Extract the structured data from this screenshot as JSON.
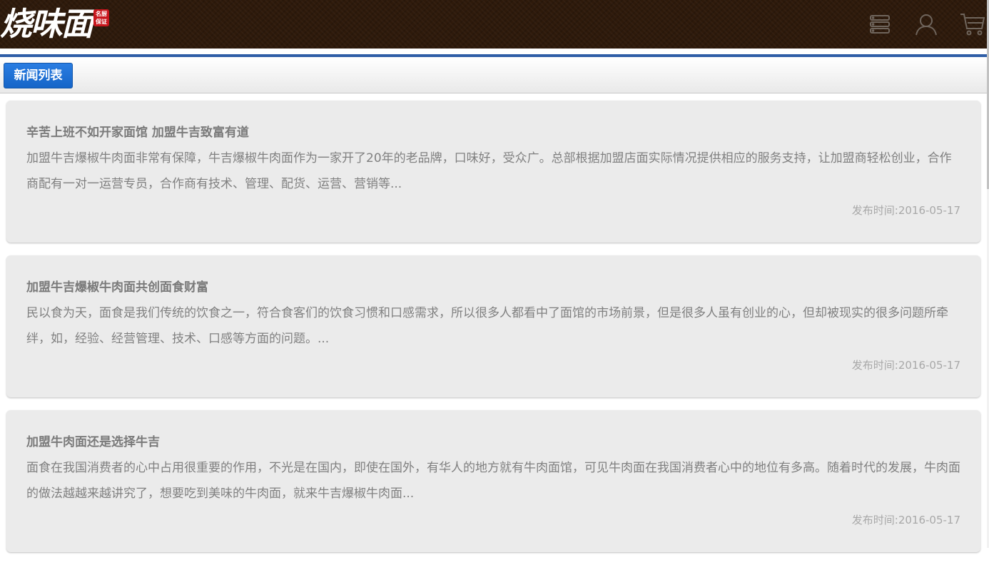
{
  "header": {
    "logo_text": "烧味面",
    "logo_seal": "名厨保证",
    "icons": [
      "menu-list-icon",
      "user-icon",
      "cart-icon"
    ],
    "background_color": "#2e1a0b"
  },
  "tabs": {
    "active_label": "新闻列表",
    "accent_color": "#1a6fd6"
  },
  "news": [
    {
      "title": "辛苦上班不如开家面馆 加盟牛吉致富有道",
      "summary": "加盟牛吉爆椒牛肉面非常有保障，牛吉爆椒牛肉面作为一家开了20年的老品牌，口味好，受众广。总部根据加盟店面实际情况提供相应的服务支持，让加盟商轻松创业，合作商配有一对一运营专员，合作商有技术、管理、配货、运营、营销等...",
      "date": "发布时间:2016-05-17"
    },
    {
      "title": "加盟牛吉爆椒牛肉面共创面食财富",
      "summary": "民以食为天，面食是我们传统的饮食之一，符合食客们的饮食习惯和口感需求，所以很多人都看中了面馆的市场前景，但是很多人虽有创业的心，但却被现实的很多问题所牵绊，如，经验、经营管理、技术、口感等方面的问题。...",
      "date": "发布时间:2016-05-17"
    },
    {
      "title": "加盟牛肉面还是选择牛吉",
      "summary": "面食在我国消费者的心中占用很重要的作用，不光是在国内，即使在国外，有华人的地方就有牛肉面馆，可见牛肉面在我国消费者心中的地位有多高。随着时代的发展，牛肉面的做法越越来越讲究了，想要吃到美味的牛肉面，就来牛吉爆椒牛肉面...",
      "date": "发布时间:2016-05-17"
    }
  ]
}
